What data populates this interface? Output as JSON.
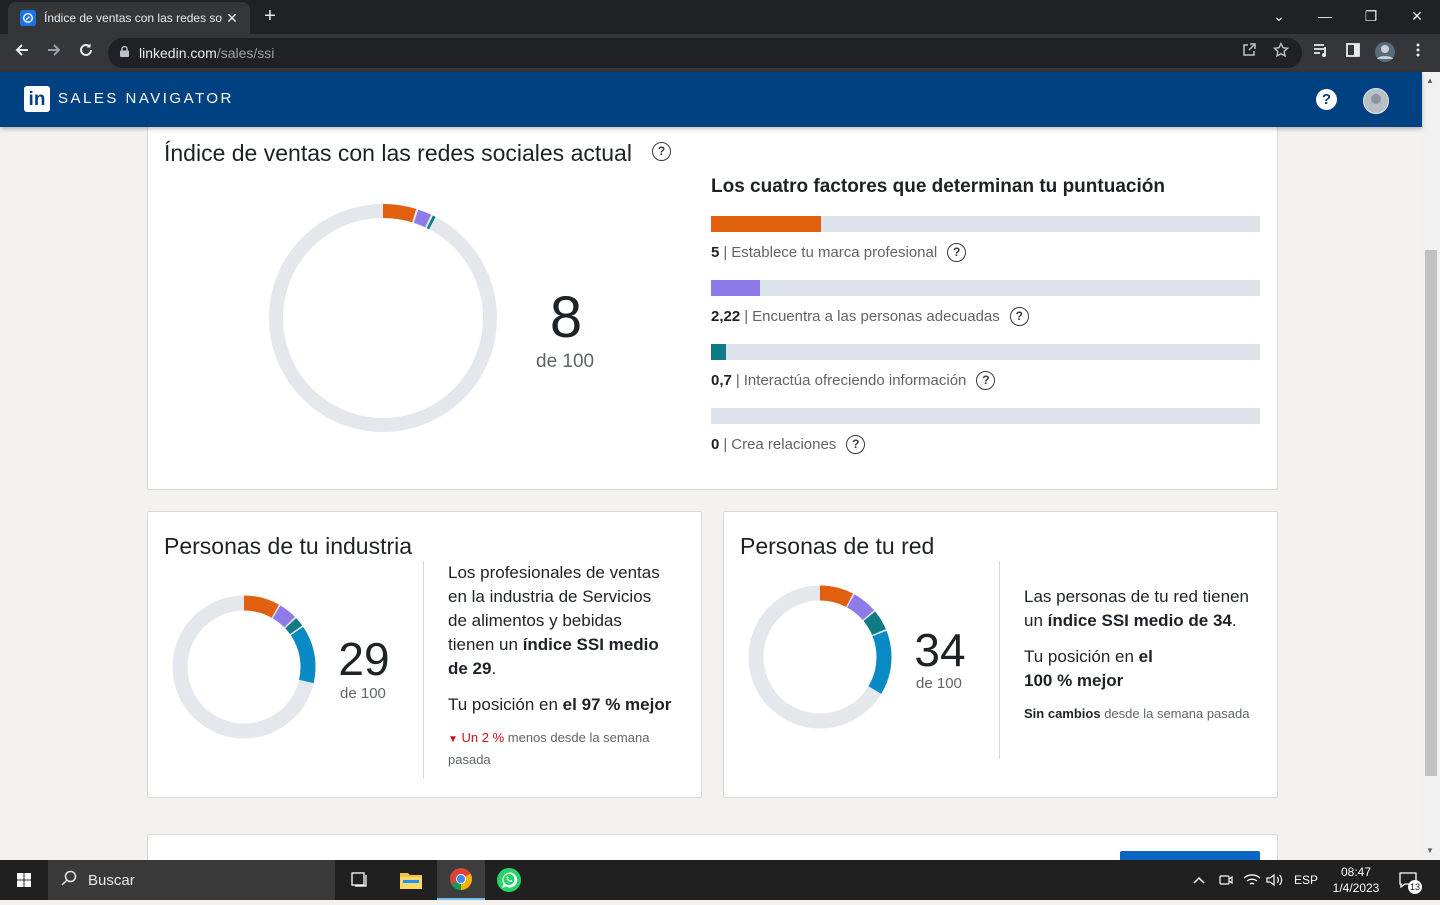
{
  "browser": {
    "tab_title": "Índice de ventas con las redes so",
    "tab_close": "✕",
    "new_tab": "+",
    "url_host": "linkedin.com",
    "url_path": "/sales/ssi",
    "window_controls": [
      "⌄",
      "—",
      "❐",
      "✕"
    ]
  },
  "header": {
    "logo_text": "in",
    "brand": "SALES NAVIGATOR",
    "help": "?"
  },
  "ssi": {
    "title": "Índice de ventas con las redes sociales actual",
    "score": 8,
    "score_label": "8",
    "out_of": "de 100",
    "factors_title": "Los cuatro factores que determinan tu puntuación",
    "factors": [
      {
        "value_label": "5",
        "value": 5,
        "max": 25,
        "label": "Establece tu marca profesional",
        "color": "#e06010"
      },
      {
        "value_label": "2,22",
        "value": 2.22,
        "max": 25,
        "label": "Encuentra a las personas adecuadas",
        "color": "#8c7be8"
      },
      {
        "value_label": "0,7",
        "value": 0.7,
        "max": 25,
        "label": "Interactúa ofreciendo información",
        "color": "#0f7b85"
      },
      {
        "value_label": "0",
        "value": 0,
        "max": 25,
        "label": "Crea relaciones",
        "color": "#0a8ac5"
      }
    ]
  },
  "industry": {
    "title": "Personas de tu industria",
    "score": 29,
    "score_label": "29",
    "out_of": "de 100",
    "segments": [
      8.5,
      4.5,
      2.5,
      13.5
    ],
    "desc_line1": "Los profesionales de ventas",
    "desc_line2": "en la industria de Servicios",
    "desc_line3": "de alimentos y bebidas",
    "desc_line4a": "tienen un ",
    "desc_line4b": "índice SSI medio",
    "desc_line5a": "de 29",
    "desc_line5b": ".",
    "rank_a": "Tu posición en ",
    "rank_b": "el 97 % mejor",
    "change_arrow": "▼",
    "change_a": "Un 2 %",
    "change_b": " menos desde la semana",
    "change_c": "pasada"
  },
  "network": {
    "title": "Personas de tu red",
    "score": 34,
    "score_label": "34",
    "out_of": "de 100",
    "segments": [
      8,
      6,
      5,
      15
    ],
    "desc_line1": "Las personas de tu red tienen",
    "desc_line2a": "un ",
    "desc_line2b": "índice SSI medio de 34",
    "desc_line2c": ".",
    "rank_a": "Tu posición en ",
    "rank_b1": "el",
    "rank_b2": "100 % mejor",
    "change_a": "Sin cambios",
    "change_b": " desde la semana pasada"
  },
  "taskbar": {
    "search_placeholder": "Buscar",
    "lang": "ESP",
    "time": "08:47",
    "date": "1/4/2023",
    "notifications": "13"
  }
}
